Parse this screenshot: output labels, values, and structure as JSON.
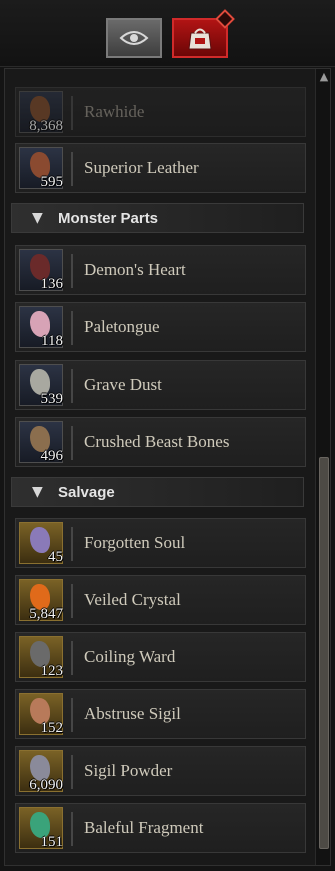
{
  "tabs": [
    {
      "icon": "eye-icon",
      "active": false
    },
    {
      "icon": "materials-bag-icon",
      "active": true,
      "badge": "notification-diamond"
    }
  ],
  "colors": {
    "active_tab": "#b11414",
    "text": "#cfcabb",
    "panel": "#191919"
  },
  "leather_items": [
    {
      "name": "Rawhide",
      "qty": "8,368",
      "art": "#7a4a2a",
      "faded": true
    },
    {
      "name": "Superior Leather",
      "qty": "595",
      "art": "#8a4a30"
    }
  ],
  "categories": {
    "monster_parts": "Monster Parts",
    "salvage": "Salvage"
  },
  "monster_items": [
    {
      "name": "Demon's Heart",
      "qty": "136",
      "art": "#6a2a2a"
    },
    {
      "name": "Paletongue",
      "qty": "118",
      "art": "#d7a3b6"
    },
    {
      "name": "Grave Dust",
      "qty": "539",
      "art": "#a8a8a0"
    },
    {
      "name": "Crushed Beast Bones",
      "qty": "496",
      "art": "#8b6e4e"
    }
  ],
  "salvage_items": [
    {
      "name": "Forgotten Soul",
      "qty": "45",
      "art": "#8a7ab8"
    },
    {
      "name": "Veiled Crystal",
      "qty": "5,847",
      "art": "#e06a1a"
    },
    {
      "name": "Coiling Ward",
      "qty": "123",
      "art": "#6a6a6a"
    },
    {
      "name": "Abstruse Sigil",
      "qty": "152",
      "art": "#b87a5a"
    },
    {
      "name": "Sigil Powder",
      "qty": "6,090",
      "art": "#8a8a9a"
    },
    {
      "name": "Baleful Fragment",
      "qty": "151",
      "art": "#3aa37a"
    }
  ]
}
